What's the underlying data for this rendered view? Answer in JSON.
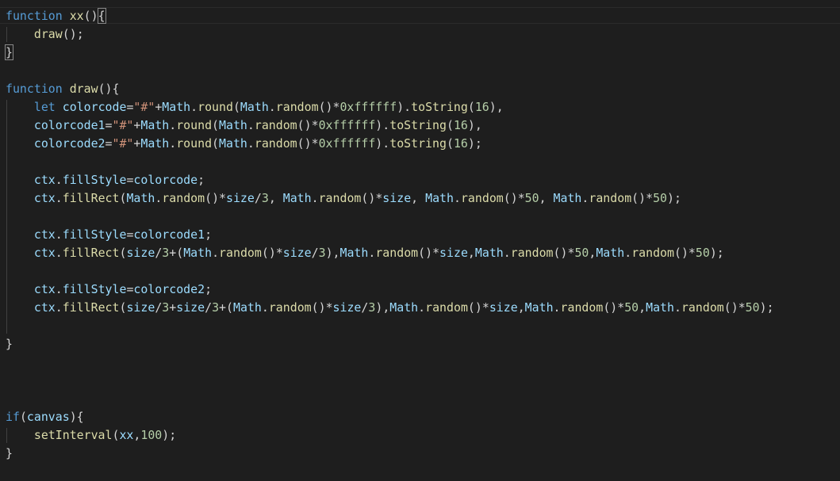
{
  "editor": {
    "language": "javascript",
    "theme": {
      "background": "#1e1e1e",
      "keyword": "#569cd6",
      "function": "#dcdcaa",
      "variable": "#9cdcfe",
      "string": "#ce9178",
      "number": "#b5cea8",
      "text": "#d4d4d4"
    },
    "lines": [
      "function xx(){",
      "    draw();",
      "}",
      "",
      "function draw(){",
      "    let colorcode=\"#\"+Math.round(Math.random()*0xffffff).toString(16),",
      "    colorcode1=\"#\"+Math.round(Math.random()*0xffffff).toString(16),",
      "    colorcode2=\"#\"+Math.round(Math.random()*0xffffff).toString(16);",
      "",
      "    ctx.fillStyle=colorcode;",
      "    ctx.fillRect(Math.random()*size/3, Math.random()*size, Math.random()*50, Math.random()*50);",
      "",
      "    ctx.fillStyle=colorcode1;",
      "    ctx.fillRect(size/3+(Math.random()*size/3),Math.random()*size,Math.random()*50,Math.random()*50);",
      "",
      "    ctx.fillStyle=colorcode2;",
      "    ctx.fillRect(size/3+size/3+(Math.random()*size/3),Math.random()*size,Math.random()*50,Math.random()*50);",
      "",
      "}",
      "",
      "",
      "",
      "if(canvas){",
      "    setInterval(xx,100);",
      "}"
    ]
  }
}
